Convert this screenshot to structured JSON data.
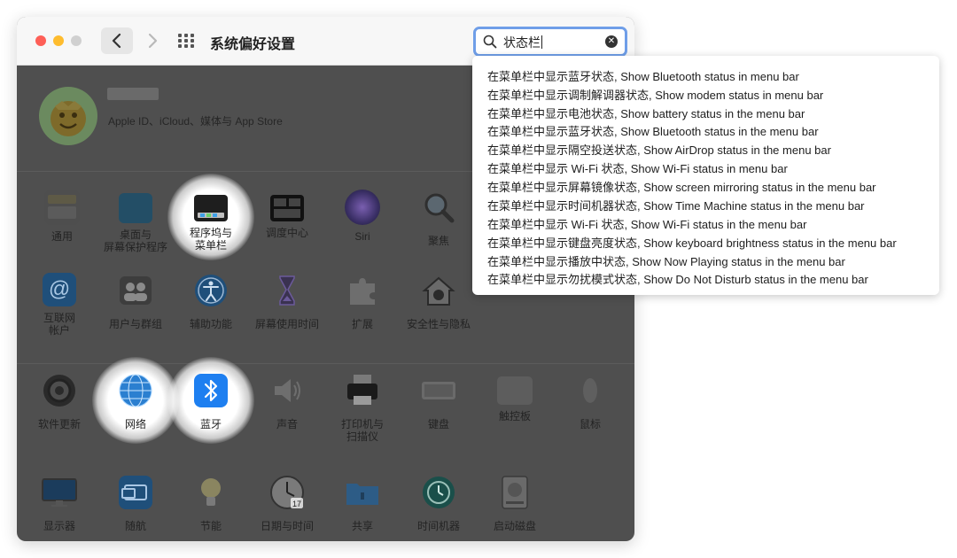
{
  "window": {
    "title": "系统偏好设置",
    "search_value": "状态栏"
  },
  "account": {
    "subtitle": "Apple ID、iCloud、媒体与 App Store"
  },
  "prefs": {
    "general": "通用",
    "desktop": [
      "桌面与",
      "屏幕保护程序"
    ],
    "dock": [
      "程序坞与",
      "菜单栏"
    ],
    "mission": "调度中心",
    "siri": "Siri",
    "spotlight": "聚焦",
    "internet": [
      "互联网",
      "帐户"
    ],
    "users": "用户与群组",
    "access": "辅助功能",
    "screentime": "屏幕使用时间",
    "extensions": "扩展",
    "security": "安全性与隐私",
    "update": "软件更新",
    "network": "网络",
    "bluetooth": "蓝牙",
    "sound": "声音",
    "printers": [
      "打印机与",
      "扫描仪"
    ],
    "keyboard": "键盘",
    "trackpad": "触控板",
    "mouse": "鼠标",
    "displays": "显示器",
    "sidecar": "随航",
    "energy": "节能",
    "datetime": "日期与时间",
    "sharing": "共享",
    "timemachine": "时间机器",
    "startup": "启动磁盘"
  },
  "calendar_day": "17",
  "results": [
    "在菜单栏中显示蓝牙状态, Show Bluetooth status in menu bar",
    "在菜单栏中显示调制解调器状态, Show modem status in menu bar",
    "在菜单栏中显示电池状态, Show battery status in the menu bar",
    "在菜单栏中显示蓝牙状态, Show Bluetooth status in the menu bar",
    "在菜单栏中显示隔空投送状态, Show AirDrop status in the menu bar",
    "在菜单栏中显示 Wi-Fi 状态, Show Wi-Fi status in menu bar",
    "在菜单栏中显示屏幕镜像状态, Show screen mirroring status in the menu bar",
    "在菜单栏中显示时间机器状态, Show Time Machine status in the menu bar",
    "在菜单栏中显示 Wi-Fi 状态, Show Wi-Fi status in the menu bar",
    "在菜单栏中显示键盘亮度状态, Show keyboard brightness status in the menu bar",
    "在菜单栏中显示播放中状态, Show Now Playing status in the menu bar",
    "在菜单栏中显示勿扰模式状态, Show Do Not Disturb status in the menu bar"
  ],
  "colors": {
    "accent": "#6f9ee8",
    "overlay": "#4f4f4f"
  }
}
